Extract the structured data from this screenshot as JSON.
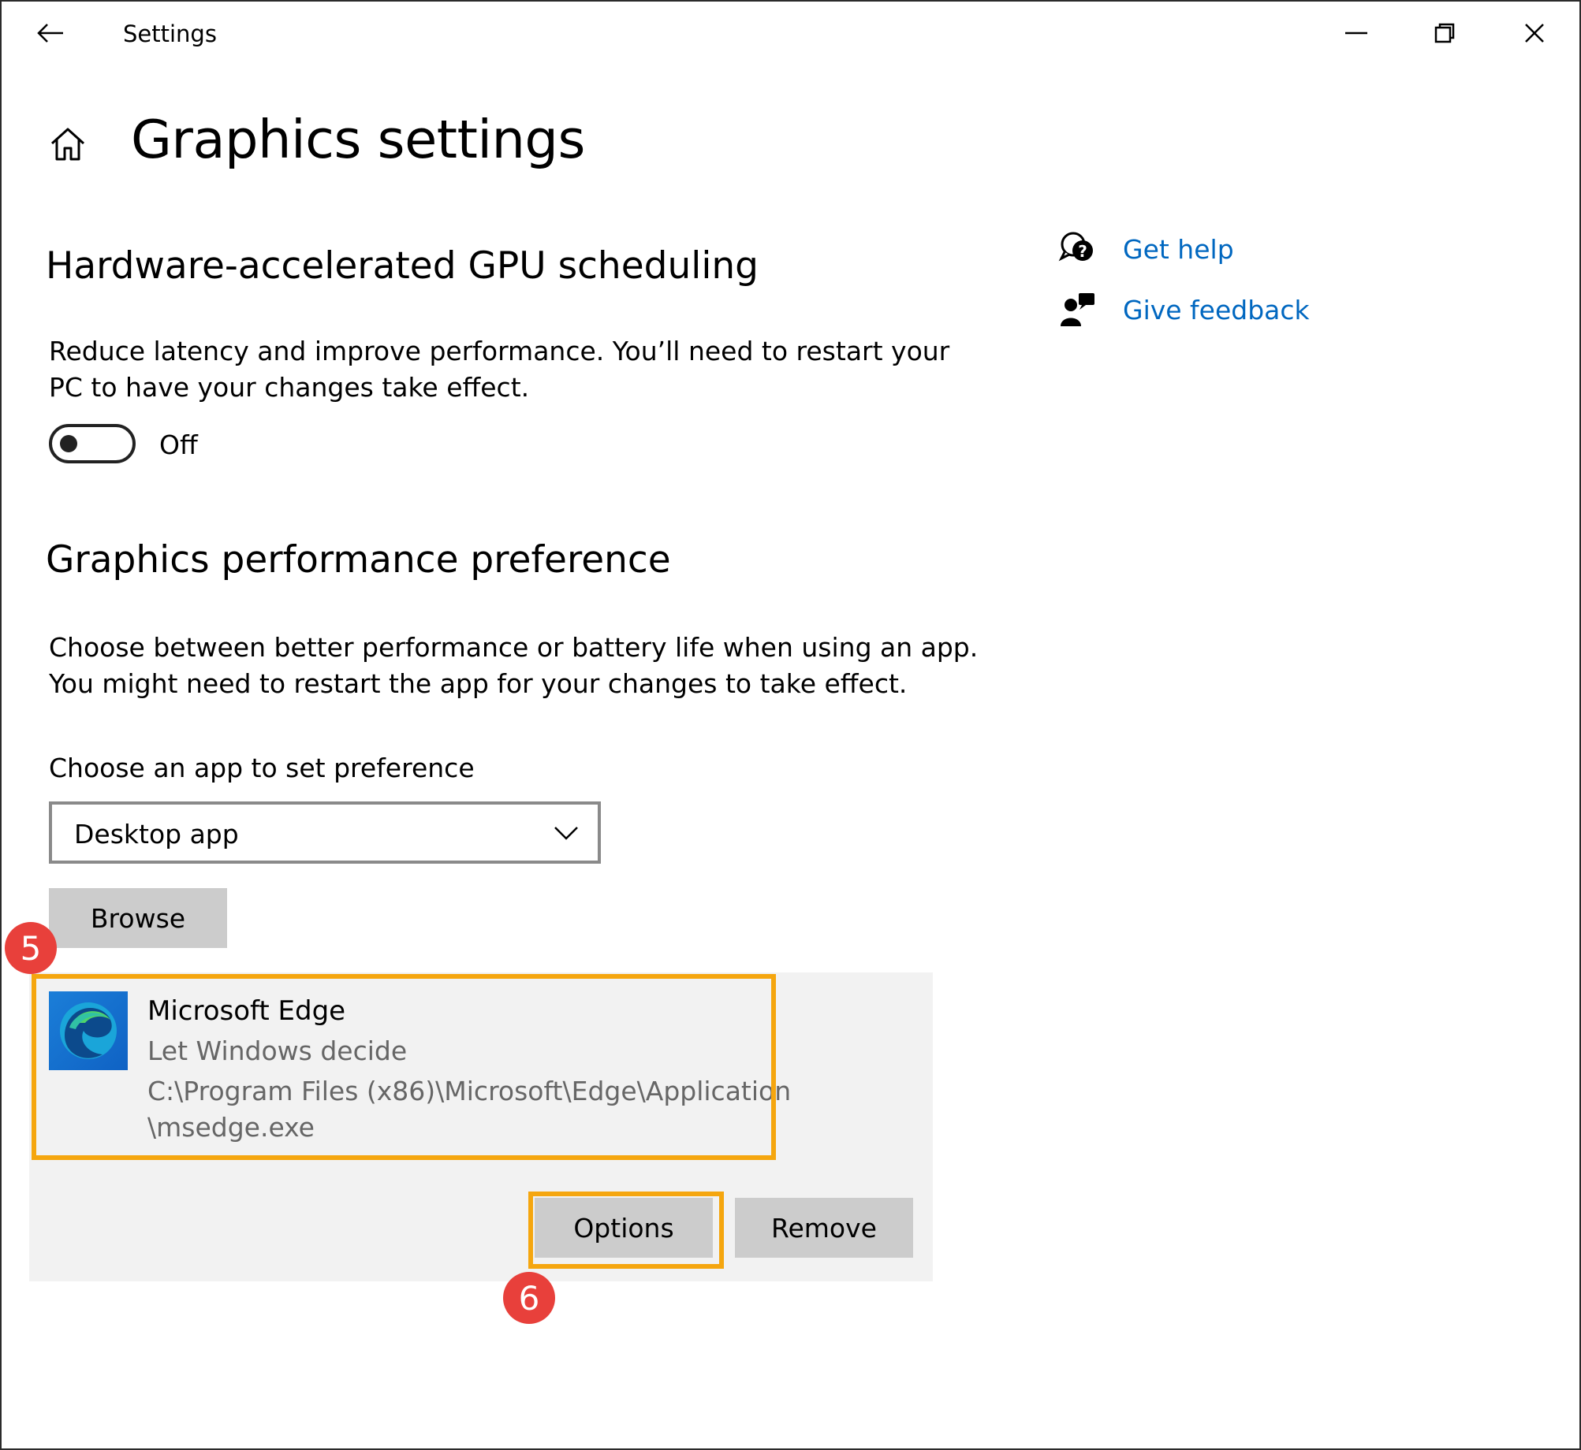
{
  "titlebar": {
    "title": "Settings",
    "back_icon": "back-arrow-icon",
    "minimize_icon": "minimize-icon",
    "restore_icon": "restore-icon",
    "close_icon": "close-icon"
  },
  "header": {
    "home_icon": "home-icon",
    "title": "Graphics settings"
  },
  "gpu_scheduling": {
    "heading": "Hardware-accelerated GPU scheduling",
    "description_line1": "Reduce latency and improve performance. You’ll need to restart your",
    "description_line2": "PC to have your changes take effect.",
    "toggle_state": "Off"
  },
  "performance_preference": {
    "heading": "Graphics performance preference",
    "description_line1": "Choose between better performance or battery life when using an app.",
    "description_line2": "You might need to restart the app for your changes to take effect.",
    "choose_label": "Choose an app to set preference",
    "app_type_selected": "Desktop app",
    "browse_label": "Browse"
  },
  "app_entry": {
    "name": "Microsoft Edge",
    "preference": "Let Windows decide",
    "path_line1": "C:\\Program Files (x86)\\Microsoft\\Edge\\Application",
    "path_line2": "\\msedge.exe",
    "options_label": "Options",
    "remove_label": "Remove"
  },
  "side_links": {
    "get_help": "Get help",
    "give_feedback": "Give feedback"
  },
  "annotations": {
    "step5": "5",
    "step6": "6",
    "highlight_color": "#f5a60f",
    "badge_color": "#e8403b"
  },
  "colors": {
    "link": "#0067c0",
    "button_bg": "#cccccc",
    "panel_bg": "#f2f2f2"
  }
}
